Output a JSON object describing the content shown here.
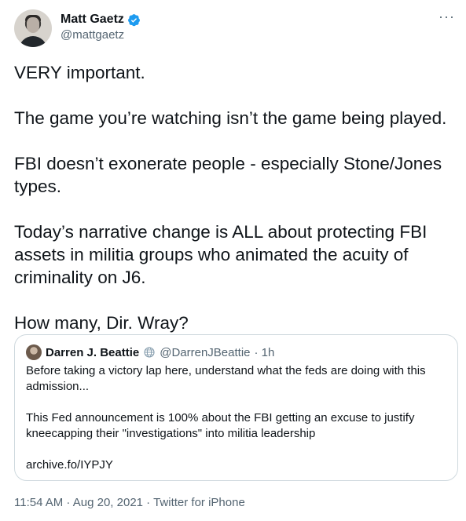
{
  "author": {
    "name": "Matt Gaetz",
    "handle": "@mattgaetz"
  },
  "more_label": "···",
  "tweet_paragraphs": [
    "VERY important.",
    "The game you’re watching isn’t the game being played.",
    "FBI doesn’t exonerate people - especially Stone/Jones types.",
    "Today’s narrative change is ALL about protecting FBI assets in militia groups who animated the acuity of criminality on J6.",
    "How many, Dir. Wray?"
  ],
  "quote": {
    "name": "Darren J. Beattie",
    "handle": "@DarrenJBeattie",
    "time": "· 1h",
    "paragraphs": [
      "Before taking a victory lap here, understand what the feds are doing with this admission...",
      "This Fed announcement is 100% about the FBI getting an excuse to justify kneecapping their \"investigations\" into militia leadership",
      "archive.fo/IYPJY"
    ]
  },
  "meta": "11:54 AM · Aug 20, 2021 · Twitter for iPhone",
  "colors": {
    "text": "#0f1419",
    "secondary": "#536471",
    "verified": "#1d9bf0",
    "border": "#cfd9de"
  }
}
